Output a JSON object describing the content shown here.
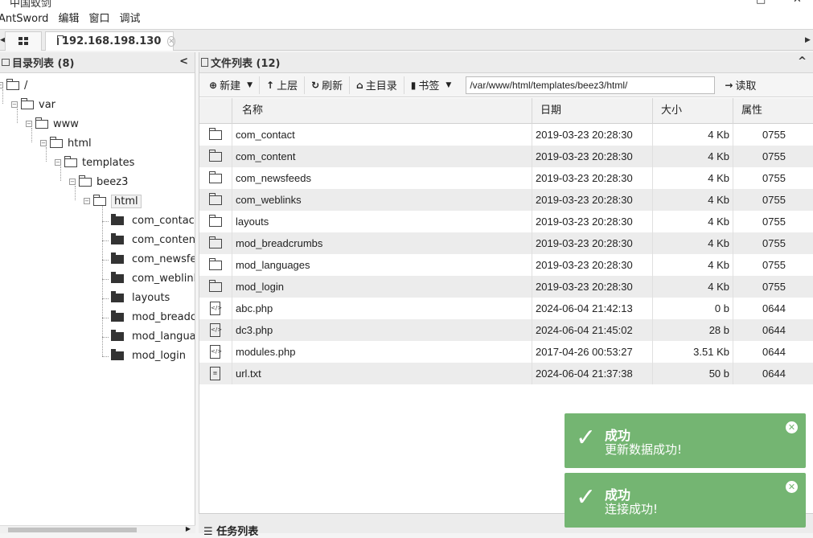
{
  "window": {
    "title": "中国蚁剑"
  },
  "menu": [
    "AntSword",
    "编辑",
    "窗口",
    "调试"
  ],
  "tabs": {
    "host_label": "192.168.198.130"
  },
  "left_panel": {
    "title": "目录列表 (8)",
    "tree": [
      {
        "label": "/"
      },
      {
        "label": "var"
      },
      {
        "label": "www"
      },
      {
        "label": "html"
      },
      {
        "label": "templates"
      },
      {
        "label": "beez3"
      },
      {
        "label": "html"
      },
      {
        "label": "com_contact"
      },
      {
        "label": "com_content"
      },
      {
        "label": "com_newsfee"
      },
      {
        "label": "com_weblinks"
      },
      {
        "label": "layouts"
      },
      {
        "label": "mod_breadcru"
      },
      {
        "label": "mod_languag"
      },
      {
        "label": "mod_login"
      }
    ]
  },
  "right_panel": {
    "title": "文件列表 (12)",
    "toolbar": {
      "new": "新建",
      "up": "上层",
      "refresh": "刷新",
      "home": "主目录",
      "bookmark": "书签",
      "path": "/var/www/html/templates/beez3/html/",
      "read": "读取"
    },
    "columns": {
      "name": "名称",
      "date": "日期",
      "size": "大小",
      "attr": "属性"
    },
    "rows": [
      {
        "type": "folder",
        "name": "com_contact",
        "date": "2019-03-23 20:28:30",
        "size": "4 Kb",
        "attr": "0755"
      },
      {
        "type": "folder",
        "name": "com_content",
        "date": "2019-03-23 20:28:30",
        "size": "4 Kb",
        "attr": "0755"
      },
      {
        "type": "folder",
        "name": "com_newsfeeds",
        "date": "2019-03-23 20:28:30",
        "size": "4 Kb",
        "attr": "0755"
      },
      {
        "type": "folder",
        "name": "com_weblinks",
        "date": "2019-03-23 20:28:30",
        "size": "4 Kb",
        "attr": "0755"
      },
      {
        "type": "folder",
        "name": "layouts",
        "date": "2019-03-23 20:28:30",
        "size": "4 Kb",
        "attr": "0755"
      },
      {
        "type": "folder",
        "name": "mod_breadcrumbs",
        "date": "2019-03-23 20:28:30",
        "size": "4 Kb",
        "attr": "0755"
      },
      {
        "type": "folder",
        "name": "mod_languages",
        "date": "2019-03-23 20:28:30",
        "size": "4 Kb",
        "attr": "0755"
      },
      {
        "type": "folder",
        "name": "mod_login",
        "date": "2019-03-23 20:28:30",
        "size": "4 Kb",
        "attr": "0755"
      },
      {
        "type": "code",
        "name": "abc.php",
        "date": "2024-06-04 21:42:13",
        "size": "0 b",
        "attr": "0644"
      },
      {
        "type": "code",
        "name": "dc3.php",
        "date": "2024-06-04 21:45:02",
        "size": "28 b",
        "attr": "0644"
      },
      {
        "type": "code",
        "name": "modules.php",
        "date": "2017-04-26 00:53:27",
        "size": "3.51 Kb",
        "attr": "0644"
      },
      {
        "type": "text",
        "name": "url.txt",
        "date": "2024-06-04 21:37:38",
        "size": "50 b",
        "attr": "0644"
      }
    ]
  },
  "bottom": {
    "tasks_label": "任务列表"
  },
  "toasts": [
    {
      "title": "成功",
      "message": "更新数据成功!"
    },
    {
      "title": "成功",
      "message": "连接成功!"
    }
  ],
  "colors": {
    "toast_bg": "#74b572",
    "row_alt": "#ececec"
  }
}
